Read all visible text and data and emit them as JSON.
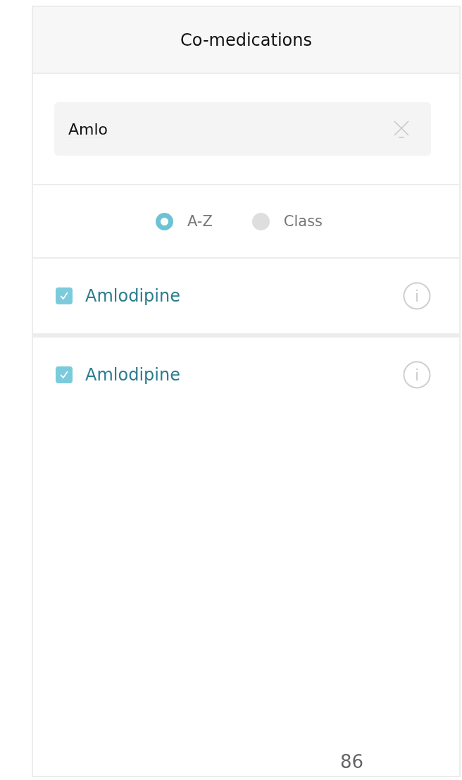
{
  "header": {
    "title": "Co-medications"
  },
  "search": {
    "value": "Amlo"
  },
  "sort_options": [
    {
      "label": "A-Z",
      "selected": true
    },
    {
      "label": "Class",
      "selected": false
    }
  ],
  "results": [
    {
      "name": "Amlodipine",
      "checked": true
    },
    {
      "name": "Amlodipine",
      "checked": true
    }
  ],
  "page_number": "86"
}
